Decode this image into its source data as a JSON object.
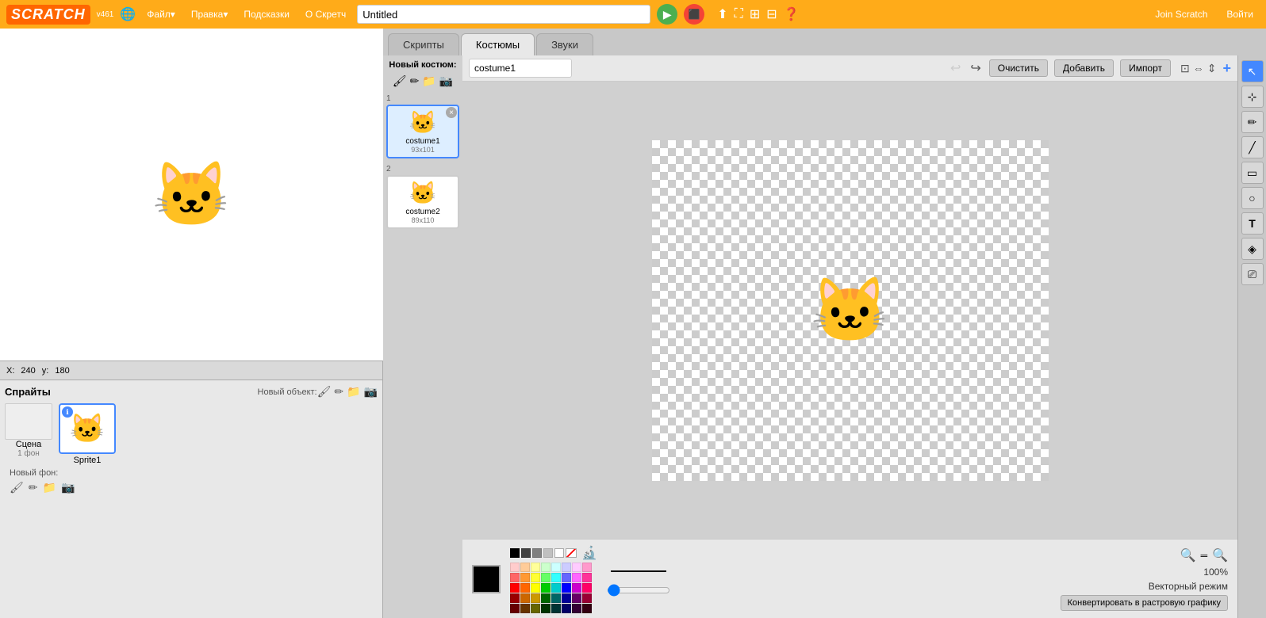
{
  "app": {
    "logo": "SCRATCH",
    "version": "v461",
    "title": "Untitled"
  },
  "topbar": {
    "menus": [
      "Файл▾",
      "Правка▾",
      "Подсказки",
      "О Скретч"
    ],
    "right_buttons": [
      "Join Scratch",
      "Войти"
    ]
  },
  "tabs": {
    "scripts": "Скрипты",
    "costumes": "Костюмы",
    "sounds": "Звуки",
    "active": "costumes"
  },
  "costume_editor": {
    "new_costume_label": "Новый костюм:",
    "toolbar": {
      "costume_name": "costume1",
      "clear_btn": "Очистить",
      "add_btn": "Добавить",
      "import_btn": "Импорт"
    },
    "costumes": [
      {
        "num": "1",
        "name": "costume1",
        "size": "93x101",
        "selected": true
      },
      {
        "num": "2",
        "name": "costume2",
        "size": "89x110",
        "selected": false
      }
    ]
  },
  "bottom_bar": {
    "zoom_level": "100%",
    "vector_mode": "Векторный режим",
    "convert_btn": "Конвертировать в растровую графику"
  },
  "stage": {
    "coords": {
      "x_label": "X:",
      "x_val": "240",
      "y_label": "y:",
      "y_val": "180"
    }
  },
  "sprites_panel": {
    "title": "Спрайты",
    "new_object_label": "Новый объект:",
    "scene_name": "Сцена",
    "scene_sub": "1 фон",
    "sprite1_name": "Sprite1",
    "new_bg_label": "Новый фон:"
  },
  "tools": [
    {
      "id": "select",
      "icon": "↖",
      "label": "select-tool",
      "active": true
    },
    {
      "id": "reshape",
      "icon": "⊹",
      "label": "reshape-tool",
      "active": false
    },
    {
      "id": "pencil",
      "icon": "✏",
      "label": "pencil-tool",
      "active": false
    },
    {
      "id": "line",
      "icon": "╱",
      "label": "line-tool",
      "active": false
    },
    {
      "id": "rect",
      "icon": "▭",
      "label": "rect-tool",
      "active": false
    },
    {
      "id": "ellipse",
      "icon": "○",
      "label": "ellipse-tool",
      "active": false
    },
    {
      "id": "text",
      "icon": "T",
      "label": "text-tool",
      "active": false
    },
    {
      "id": "fill",
      "icon": "◈",
      "label": "fill-tool",
      "active": false
    },
    {
      "id": "eraser",
      "icon": "⎚",
      "label": "eraser-tool",
      "active": false
    }
  ],
  "colors": {
    "current": "#000000",
    "swatches_row1": [
      "#000000",
      "#404040",
      "#808080",
      "#c0c0c0",
      "#ffffff",
      "#ff4444"
    ],
    "grid": [
      [
        "#ffcccc",
        "#ffcc99",
        "#ffff99",
        "#ccffcc",
        "#ccffff",
        "#ccccff",
        "#ffccff",
        "#ff99cc"
      ],
      [
        "#ff6666",
        "#ff9933",
        "#ffff33",
        "#66ff66",
        "#33ffff",
        "#6666ff",
        "#ff66ff",
        "#ff3399"
      ],
      [
        "#ff0000",
        "#ff6600",
        "#ffff00",
        "#00cc00",
        "#00cccc",
        "#0000ff",
        "#cc00cc",
        "#ff0066"
      ],
      [
        "#990000",
        "#cc6600",
        "#cc9900",
        "#006600",
        "#006666",
        "#000099",
        "#660066",
        "#990033"
      ],
      [
        "#660000",
        "#663300",
        "#666600",
        "#003300",
        "#003333",
        "#000066",
        "#330033",
        "#330011"
      ]
    ]
  }
}
